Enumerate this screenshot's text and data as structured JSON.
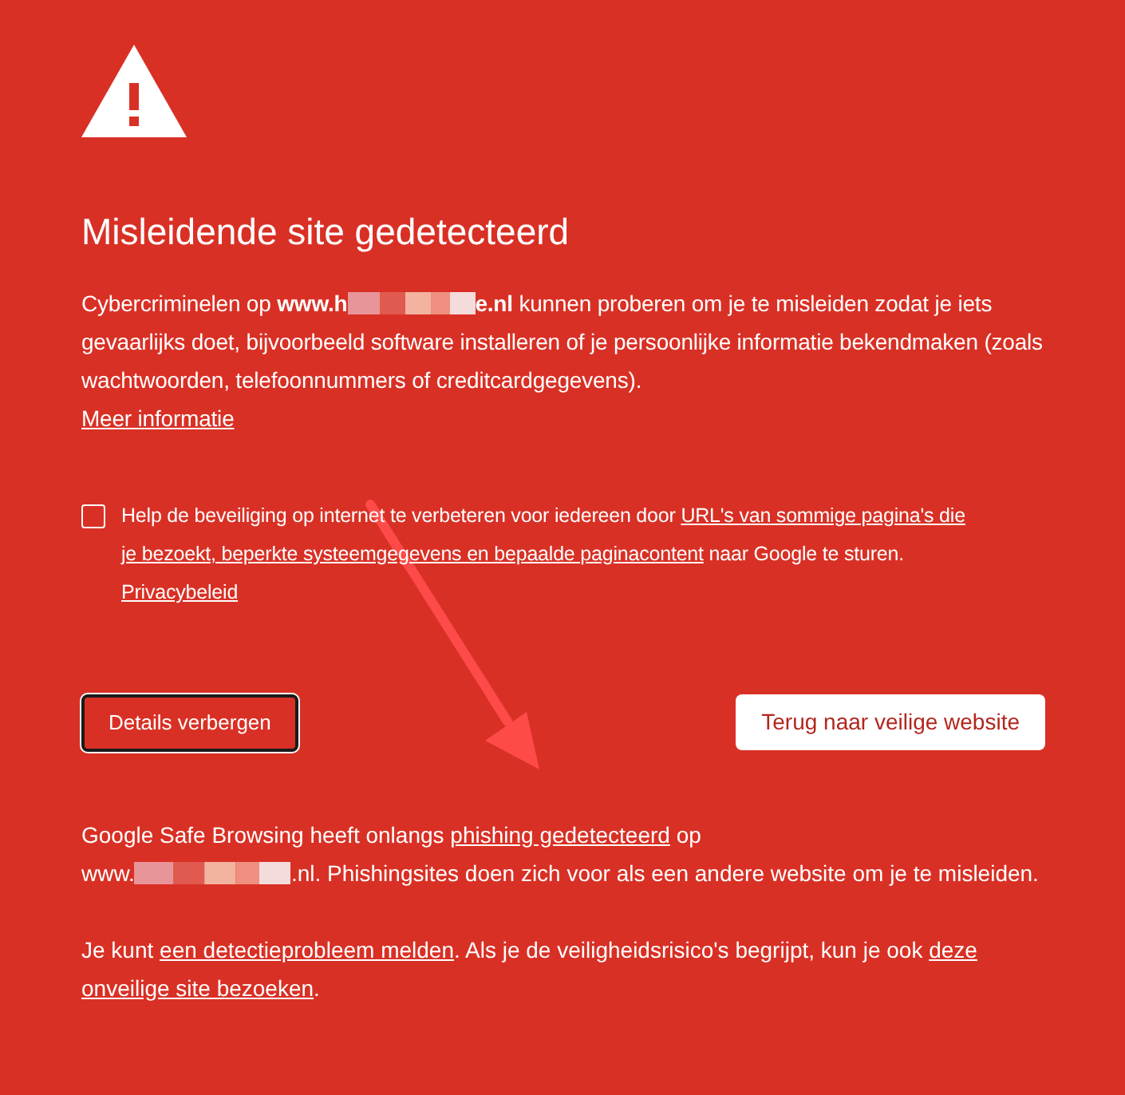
{
  "heading": "Misleidende site gedetecteerd",
  "intro": {
    "prefix": "Cybercriminelen op ",
    "domain_start": "www.h",
    "domain_end": "e.nl",
    "suffix": " kunnen proberen om je te misleiden zodat je iets gevaarlijks doet, bijvoorbeeld software installeren of je persoonlijke informatie bekendmaken (zoals wachtwoorden, telefoonnummers of creditcardgegevens).",
    "link": "Meer informatie"
  },
  "report": {
    "checked": false,
    "before": "Help de beveiliging op internet te verbeteren voor iedereen door ",
    "link": "URL's van sommige pagina's die",
    "link_cont": "je bezoekt, beperkte systeemgegevens en bepaalde paginacontent",
    "after": " naar Google te sturen.",
    "privacy": "Privacybeleid"
  },
  "buttons": [
    {
      "label": "Details verbergen",
      "kind": "outline"
    },
    {
      "label": "Terug naar veilige website",
      "kind": "primary"
    }
  ],
  "details": {
    "before": "Google Safe Browsing heeft onlangs ",
    "link": "phishing gedetecteerd",
    "middle": " op ",
    "domain_start": "www.",
    "domain_end": ".nl",
    "after": ". Phishingsites doen zich voor als een andere website om je te misleiden."
  },
  "help": {
    "before": "Je kunt ",
    "link1": "een detectieprobleem melden",
    "middle": ". Als je de veiligheidsrisico's begrijpt, kun je ook ",
    "link2": "deze",
    "link2_cont": "onveilige site bezoeken",
    "after": "."
  }
}
